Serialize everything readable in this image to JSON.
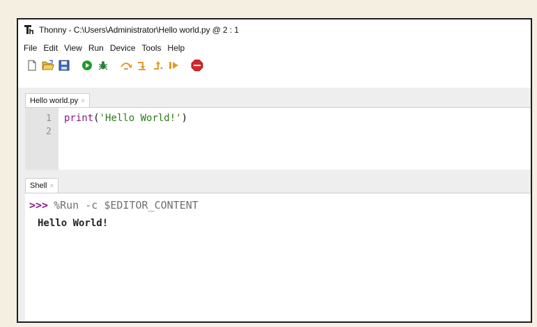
{
  "window": {
    "title": "Thonny  -  C:\\Users\\Administrator\\Hello world.py  @  2 : 1",
    "app_icon": "thonny-logo-icon"
  },
  "menubar": {
    "items": [
      "File",
      "Edit",
      "View",
      "Run",
      "Device",
      "Tools",
      "Help"
    ]
  },
  "toolbar": {
    "buttons": [
      "new-file-icon",
      "open-file-icon",
      "save-icon",
      "run-icon",
      "debug-icon",
      "step-over-icon",
      "step-into-icon",
      "step-out-icon",
      "resume-icon",
      "stop-icon"
    ]
  },
  "editor": {
    "tab_label": "Hello world.py",
    "tab_close": "×",
    "line_numbers": [
      "1",
      "2"
    ],
    "code": {
      "keyword": "print",
      "open": "(",
      "string": "'Hello World!'",
      "close": ")"
    }
  },
  "shell": {
    "tab_label": "Shell",
    "tab_close": "×",
    "prompt": ">>>",
    "command": "%Run -c $EDITOR_CONTENT",
    "output": "Hello World!"
  },
  "colors": {
    "keyword": "#8a1a80",
    "string": "#2a7a15",
    "run_green": "#1f9a2a",
    "stop_red": "#d9252a"
  }
}
